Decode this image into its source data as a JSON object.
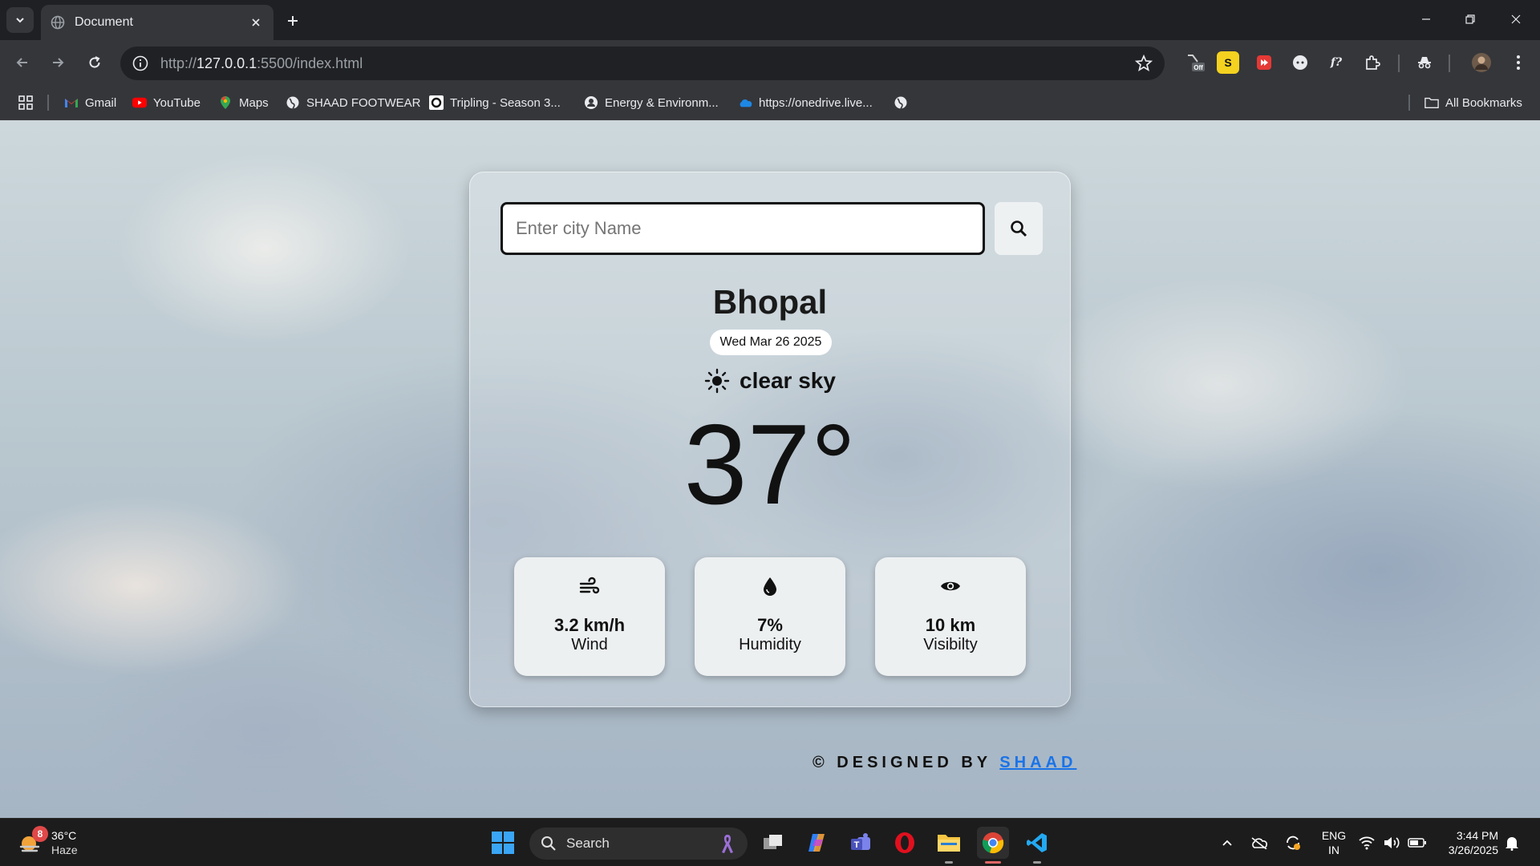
{
  "browser": {
    "tab_title": "Document",
    "url_prefix": "http://",
    "url_host": "127.0.0.1",
    "url_rest": ":5500/index.html",
    "bookmarks": [
      {
        "label": "Gmail",
        "icon": "gmail-icon"
      },
      {
        "label": "YouTube",
        "icon": "youtube-icon"
      },
      {
        "label": "Maps",
        "icon": "maps-icon"
      },
      {
        "label": "SHAAD FOOTWEAR",
        "icon": "globe-icon"
      },
      {
        "label": "Tripling - Season 3...",
        "icon": "tvf-icon"
      },
      {
        "label": "Energy & Environm...",
        "icon": "course-icon"
      },
      {
        "label": "https://onedrive.live...",
        "icon": "onedrive-icon"
      }
    ],
    "all_bookmarks": "All Bookmarks",
    "extension_badge": "Off"
  },
  "weather_app": {
    "search_placeholder": "Enter city Name",
    "city": "Bhopal",
    "date": "Wed Mar 26 2025",
    "condition": "clear sky",
    "condition_icon": "sun-icon",
    "temperature": "37°",
    "metrics": [
      {
        "value": "3.2 km/h",
        "label": "Wind",
        "icon": "wind-icon"
      },
      {
        "value": "7%",
        "label": "Humidity",
        "icon": "droplet-icon"
      },
      {
        "value": "10 km",
        "label": "Visibilty",
        "icon": "eye-icon"
      }
    ],
    "credit_prefix": "© DESIGNED BY",
    "credit_name": "SHAAD"
  },
  "taskbar": {
    "weather_temp": "36°C",
    "weather_cond": "Haze",
    "weather_badge": "8",
    "search_label": "Search",
    "lang_line1": "ENG",
    "lang_line2": "IN",
    "time": "3:44 PM",
    "date": "3/26/2025"
  },
  "colors": {
    "accent_link": "#1a73e8",
    "card_border": "#ffffff",
    "metric_bg": "#edf0f1"
  }
}
